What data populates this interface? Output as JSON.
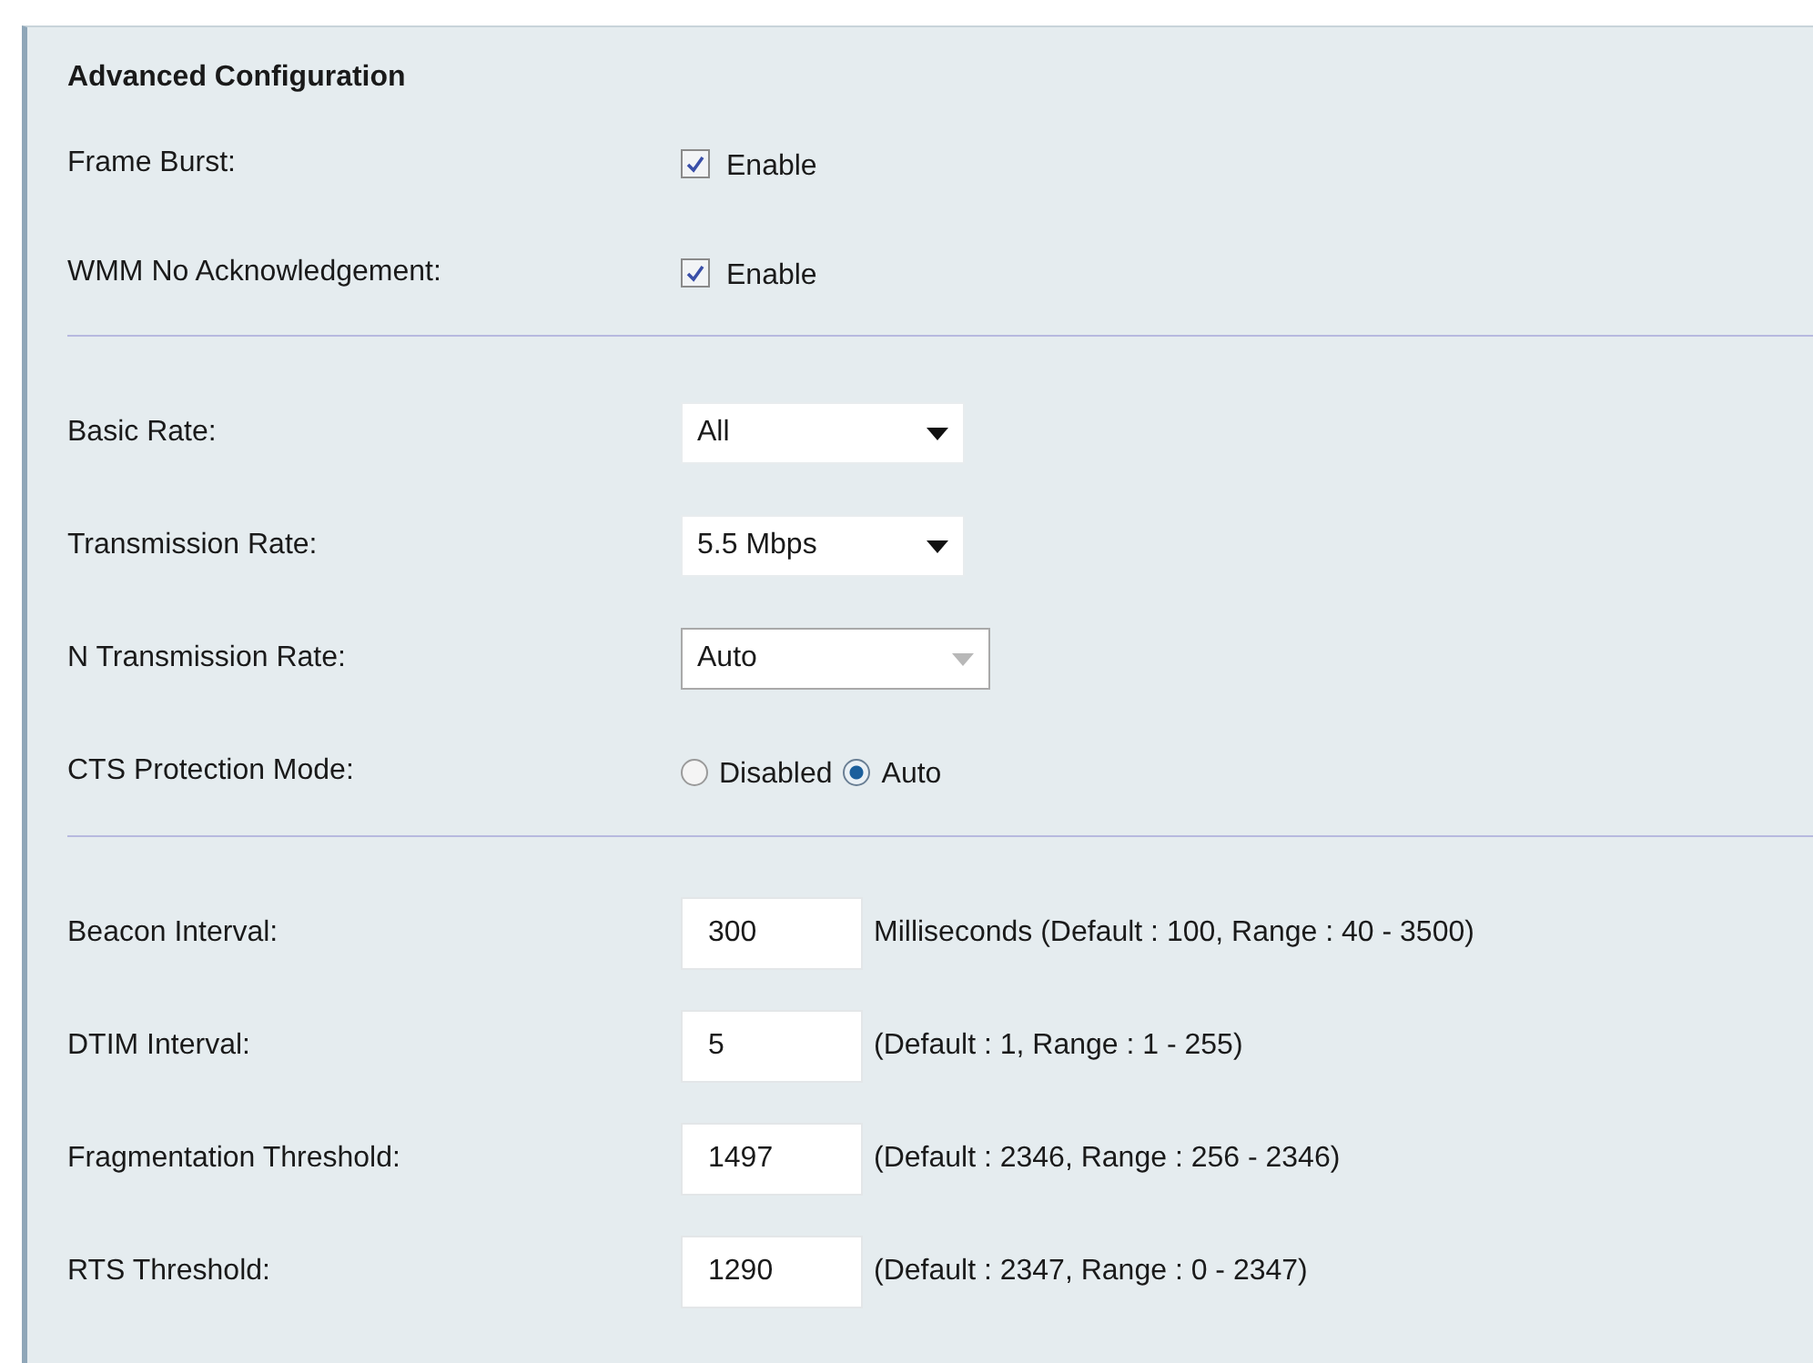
{
  "panel": {
    "title": "Advanced Configuration",
    "sections": [
      {
        "rows": [
          {
            "kind": "checkbox",
            "label": "Frame Burst:",
            "option": "Enable",
            "checked": true
          },
          {
            "kind": "checkbox",
            "label": "WMM No Acknowledgement:",
            "option": "Enable",
            "checked": true
          }
        ]
      },
      {
        "rows": [
          {
            "kind": "select",
            "label": "Basic Rate:",
            "value": "All",
            "disabled": false
          },
          {
            "kind": "select",
            "label": "Transmission Rate:",
            "value": "5.5 Mbps",
            "disabled": false
          },
          {
            "kind": "select",
            "label": "N Transmission Rate:",
            "value": "Auto",
            "disabled": true
          },
          {
            "kind": "radio",
            "label": "CTS Protection Mode:",
            "options": [
              {
                "label": "Disabled",
                "selected": false
              },
              {
                "label": "Auto",
                "selected": true
              }
            ]
          }
        ]
      },
      {
        "rows": [
          {
            "kind": "text",
            "label": "Beacon Interval:",
            "value": "300",
            "hint": "Milliseconds (Default : 100, Range : 40 - 3500)"
          },
          {
            "kind": "text",
            "label": "DTIM Interval:",
            "value": "5",
            "hint": "(Default : 1, Range : 1 - 255)"
          },
          {
            "kind": "text",
            "label": "Fragmentation Threshold:",
            "value": "1497",
            "hint": "(Default : 2346, Range : 256 - 2346)"
          },
          {
            "kind": "text",
            "label": "RTS Threshold:",
            "value": "1290",
            "hint": "(Default : 2347, Range : 0 - 2347)"
          }
        ]
      }
    ]
  }
}
